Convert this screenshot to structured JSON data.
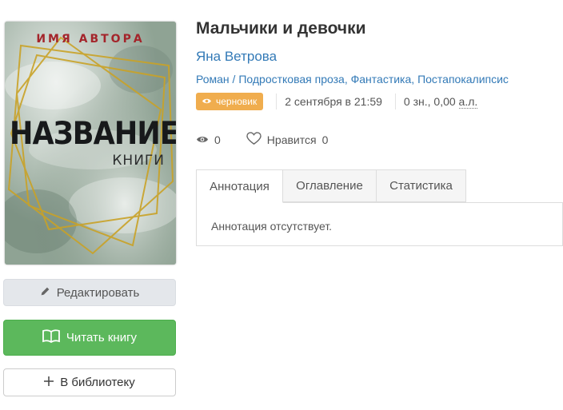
{
  "cover": {
    "author_text": "ИМЯ АВТОРА",
    "title_text": "НАЗВАНИЕ",
    "subtitle_text": "КНИГИ"
  },
  "buttons": {
    "edit_label": "Редактировать",
    "read_label": "Читать книгу",
    "library_label": "В библиотеку",
    "edit_icon": "pencil-icon",
    "read_icon": "open-book-icon",
    "library_icon": "plus-icon"
  },
  "book": {
    "title": "Мальчики и девочки",
    "author": "Яна Ветрова",
    "genres": [
      "Роман",
      "Подростковая проза",
      "Фантастика",
      "Постапокалипсис"
    ],
    "status_badge": "черновик",
    "date": "2 сентября в 21:59",
    "size_prefix": "0 зн., 0,00 ",
    "size_unit": "а.л."
  },
  "stats": {
    "views": "0",
    "likes_label": "Нравится",
    "likes": "0"
  },
  "tabs": [
    {
      "label": "Аннотация",
      "active": true
    },
    {
      "label": "Оглавление",
      "active": false
    },
    {
      "label": "Статистика",
      "active": false
    }
  ],
  "annotation_text": "Аннотация отсутствует.",
  "colors": {
    "link": "#337ab7",
    "badge": "#f0ad4e",
    "read_button": "#5cb85c",
    "cover_author": "#a4252b"
  }
}
